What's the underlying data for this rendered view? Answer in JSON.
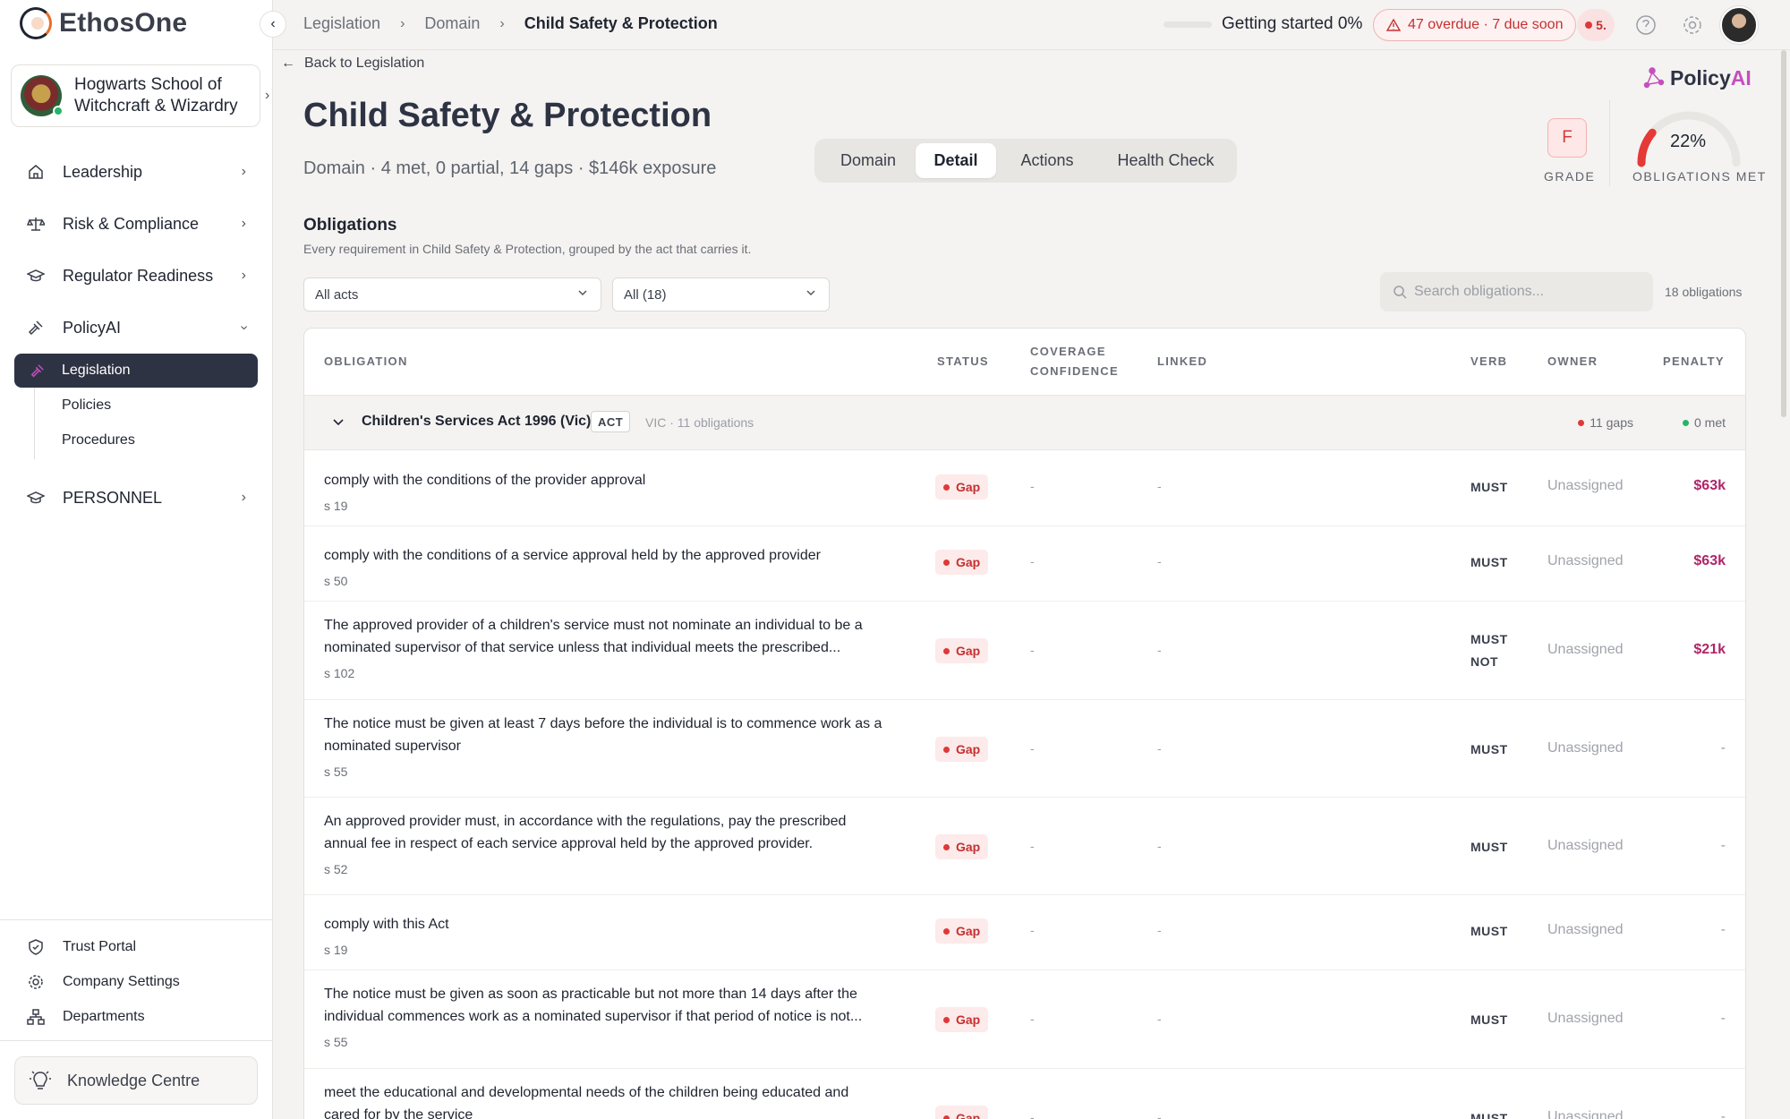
{
  "app": {
    "name": "EthosOne"
  },
  "org": {
    "name_line1": "Hogwarts School of",
    "name_line2": "Witchcraft & Wizardry"
  },
  "nav": {
    "leadership": "Leadership",
    "risk": "Risk & Compliance",
    "regulator": "Regulator Readiness",
    "policyai": "PolicyAI",
    "legislation": "Legislation",
    "policies": "Policies",
    "procedures": "Procedures",
    "personnel": "PERSONNEL"
  },
  "footer_nav": {
    "trust": "Trust Portal",
    "settings": "Company Settings",
    "departments": "Departments",
    "knowledge": "Knowledge Centre"
  },
  "breadcrumb": {
    "item1": "Legislation",
    "item2": "Domain",
    "current": "Child Safety & Protection"
  },
  "topbar": {
    "getting_started": "Getting started 0%",
    "overdue": "47 overdue · 7 due soon",
    "alert_count": "5."
  },
  "page": {
    "back": "Back to Legislation",
    "title": "Child Safety & Protection",
    "subtitle": "Domain · 4 met, 0 partial, 14 gaps · $146k exposure"
  },
  "tabs": [
    {
      "label": "Domain"
    },
    {
      "label": "Detail"
    },
    {
      "label": "Actions"
    },
    {
      "label": "Health Check"
    }
  ],
  "policyai_brand": {
    "prefix": "Policy",
    "suffix": "AI"
  },
  "grade": {
    "value": "F",
    "label": "GRADE"
  },
  "obligations_met": {
    "value": "22%",
    "fraction": 0.22,
    "label": "OBLIGATIONS MET"
  },
  "obligations": {
    "title": "Obligations",
    "description": "Every requirement in Child Safety & Protection, grouped by the act that carries it.",
    "filter_act": "All acts",
    "filter_status": "All (18)",
    "search_placeholder": "Search obligations...",
    "count": "18 obligations"
  },
  "columns": {
    "obligation": "OBLIGATION",
    "status": "STATUS",
    "coverage1": "COVERAGE",
    "coverage2": "CONFIDENCE",
    "linked": "LINKED",
    "verb": "VERB",
    "owner": "OWNER",
    "penalty": "PENALTY"
  },
  "group": {
    "name": "Children's Services Act 1996 (Vic)",
    "badge": "ACT",
    "meta": "VIC · 11 obligations",
    "gaps": "11 gaps",
    "met": "0 met"
  },
  "rows": [
    {
      "line1": "comply with the conditions of the provider approval",
      "line2": "",
      "section": "s 19",
      "status": "Gap",
      "coverage": "-",
      "linked": "-",
      "verb1": "MUST",
      "verb2": "",
      "owner": "Unassigned",
      "penalty": "$63k"
    },
    {
      "line1": "comply with the conditions of a service approval held by the approved provider",
      "line2": "",
      "section": "s 50",
      "status": "Gap",
      "coverage": "-",
      "linked": "-",
      "verb1": "MUST",
      "verb2": "",
      "owner": "Unassigned",
      "penalty": "$63k"
    },
    {
      "line1": "The approved provider of a children's service must not nominate an individual to be a",
      "line2": "nominated supervisor of that service unless that individual meets the prescribed...",
      "section": "s 102",
      "status": "Gap",
      "coverage": "-",
      "linked": "-",
      "verb1": "MUST",
      "verb2": "NOT",
      "owner": "Unassigned",
      "penalty": "$21k"
    },
    {
      "line1": "The notice must be given at least 7 days before the individual is to commence work as a",
      "line2": "nominated supervisor",
      "section": "s 55",
      "status": "Gap",
      "coverage": "-",
      "linked": "-",
      "verb1": "MUST",
      "verb2": "",
      "owner": "Unassigned",
      "penalty": "-"
    },
    {
      "line1": "An approved provider must, in accordance with the regulations, pay the prescribed",
      "line2": "annual fee in respect of each service approval held by the approved provider.",
      "section": "s 52",
      "status": "Gap",
      "coverage": "-",
      "linked": "-",
      "verb1": "MUST",
      "verb2": "",
      "owner": "Unassigned",
      "penalty": "-"
    },
    {
      "line1": "comply with this Act",
      "line2": "",
      "section": "s 19",
      "status": "Gap",
      "coverage": "-",
      "linked": "-",
      "verb1": "MUST",
      "verb2": "",
      "owner": "Unassigned",
      "penalty": "-"
    },
    {
      "line1": "The notice must be given as soon as practicable but not more than 14 days after the",
      "line2": "individual commences work as a nominated supervisor if that period of notice is not...",
      "section": "s 55",
      "status": "Gap",
      "coverage": "-",
      "linked": "-",
      "verb1": "MUST",
      "verb2": "",
      "owner": "Unassigned",
      "penalty": "-"
    },
    {
      "line1": "meet the educational and developmental needs of the children being educated and",
      "line2": "cared for by the service",
      "section": "",
      "status": "Gap",
      "coverage": "-",
      "linked": "-",
      "verb1": "MUST",
      "verb2": "",
      "owner": "Unassigned",
      "penalty": "-"
    }
  ]
}
